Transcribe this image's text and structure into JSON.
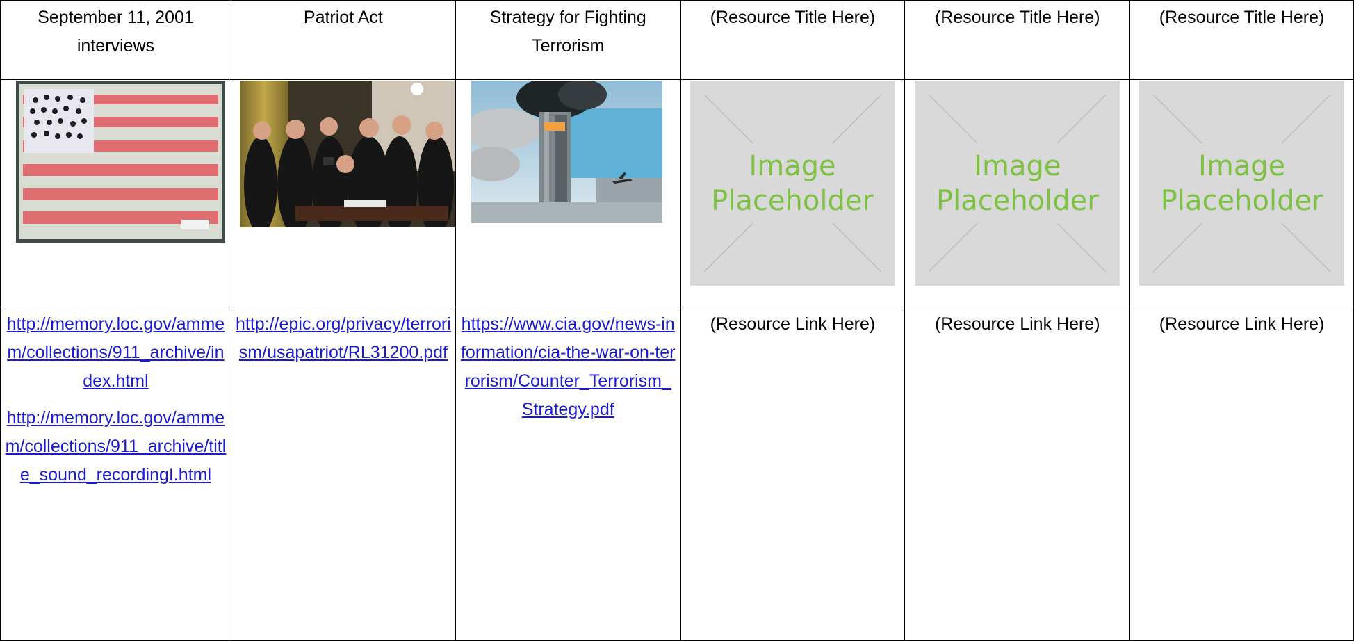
{
  "columns": [
    {
      "title": "September 11, 2001 interviews",
      "image_alt": "hand-drawn american flag",
      "links": [
        "http://memory.loc.gov/ammem/collections/911_archive/index.html",
        "http://memory.loc.gov/ammem/collections/911_archive/title_sound_recordingI.html"
      ]
    },
    {
      "title": "Patriot Act",
      "image_alt": "patriot act signing photo",
      "links": [
        "http://epic.org/privacy/terrorism/usapatriot/RL31200.pdf"
      ]
    },
    {
      "title": "Strategy for Fighting Terrorism",
      "image_alt": "world trade center tower photo",
      "links": [
        "https://www.cia.gov/news-information/cia-the-war-on-terrorism/Counter_Terrorism_Strategy.pdf"
      ]
    },
    {
      "title": "(Resource Title Here)",
      "placeholder": "Image Placeholder",
      "link_text": "(Resource Link Here)"
    },
    {
      "title": "(Resource Title Here)",
      "placeholder": "Image Placeholder",
      "link_text": "(Resource Link Here)"
    },
    {
      "title": "(Resource Title Here)",
      "placeholder": "Image Placeholder",
      "link_text": "(Resource Link Here)"
    }
  ],
  "colors": {
    "link": "#1a1ad6",
    "placeholder_bg": "#d9d9d9",
    "placeholder_text": "#7dc142"
  }
}
